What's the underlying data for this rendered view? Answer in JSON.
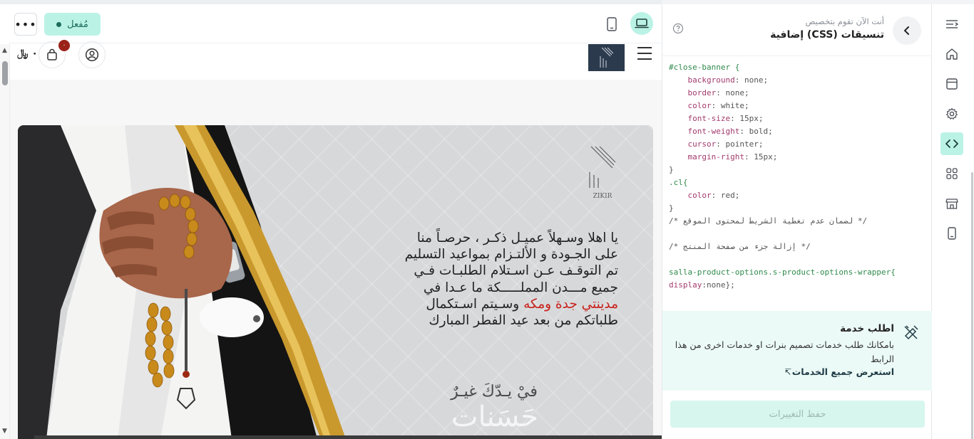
{
  "toolbar": {
    "more_label": "•••",
    "status_label": "مُفعل"
  },
  "store": {
    "currency": "٠ ﷼",
    "cart_count": "٠"
  },
  "banner": {
    "text_line1": "يا اهلا وسـهلاً عميـل ذكـر ، حرصـاً منا",
    "text_line2": "على الجـودة و الألتـزام بمواعيد التسليم",
    "text_line3": "تم التوقـف عـن اسـتلام الطلبـات فـي",
    "text_line4": "جميع مـــدن المملـــــكة ما عـدا في",
    "text_red": "مدينتي جدة ومكه",
    "text_line5_rest": " وسـيتم اسـتكمال",
    "text_line6": "طلباتكم من بعد عيد الفطر المبارك",
    "slogan": "فيْ يـدّكَ غيـرٌ",
    "slogan_sub": "حَسَنات",
    "logo_text": "ZIKIR"
  },
  "panel": {
    "subtitle": "أنت الآن تقوم بتخصيص",
    "title": "تنسيقات (CSS) إضافية",
    "code_lines": [
      [
        {
          "t": "#close-banner {",
          "c": "sel"
        }
      ],
      [
        {
          "t": "    background",
          "c": "prop"
        },
        {
          "t": ": none;",
          "c": "val"
        }
      ],
      [
        {
          "t": "    border",
          "c": "prop"
        },
        {
          "t": ": none;",
          "c": "val"
        }
      ],
      [
        {
          "t": "    color",
          "c": "prop"
        },
        {
          "t": ": white;",
          "c": "val"
        }
      ],
      [
        {
          "t": "    font-size",
          "c": "prop"
        },
        {
          "t": ": 15px;",
          "c": "val"
        }
      ],
      [
        {
          "t": "    font-weight",
          "c": "prop"
        },
        {
          "t": ": bold;",
          "c": "val"
        }
      ],
      [
        {
          "t": "    cursor",
          "c": "prop"
        },
        {
          "t": ": pointer;",
          "c": "val"
        }
      ],
      [
        {
          "t": "    margin-right",
          "c": "prop"
        },
        {
          "t": ": 15px;",
          "c": "val"
        }
      ],
      [
        {
          "t": "}",
          "c": "val"
        }
      ],
      [
        {
          "t": ".cl{",
          "c": "sel"
        }
      ],
      [
        {
          "t": "    color",
          "c": "prop"
        },
        {
          "t": ": red;",
          "c": "val"
        }
      ],
      [
        {
          "t": "}",
          "c": "val"
        }
      ],
      [
        {
          "t": "/* لضمان عدم تغطية الشريط لمحتوى الموقع */",
          "c": "com"
        }
      ],
      [
        {
          "t": "",
          "c": "val"
        }
      ],
      [
        {
          "t": "/* إزالة جزء من صفحة المنتج */",
          "c": "com"
        }
      ],
      [
        {
          "t": "",
          "c": "val"
        }
      ],
      [
        {
          "t": "salla-product-options.s-product-options-wrapper{",
          "c": "sel"
        }
      ],
      [
        {
          "t": "display",
          "c": "prop"
        },
        {
          "t": ":none};",
          "c": "val"
        }
      ]
    ],
    "service_title": "اطلب خدمة",
    "service_desc": "بامكانك طلب خدمات تصميم بنرات او خدمات اخرى من هذا الرابط",
    "service_link": "استعرض جميع الخدمات",
    "service_link_arrow": "↸",
    "save_label": "حفظ التغييرات"
  },
  "colors": {
    "accent": "#baf3e6",
    "accent_text": "#1e6d5c",
    "highlight_red": "#c8201a"
  },
  "icons": {
    "rail": [
      "collapse-icon",
      "home-icon",
      "layout-icon",
      "settings-icon",
      "code-icon",
      "apps-icon",
      "store-icon",
      "mobile-icon"
    ]
  }
}
